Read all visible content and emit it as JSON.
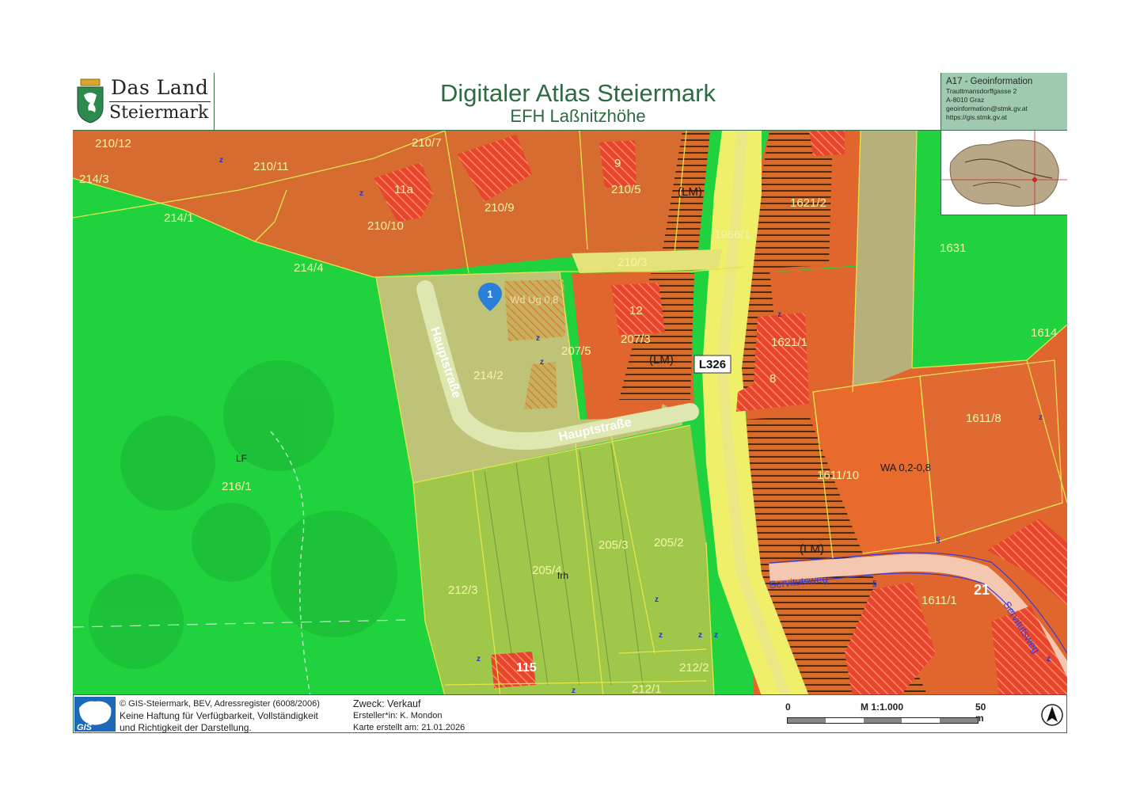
{
  "header": {
    "logo_line1": "Das Land",
    "logo_line2": "Steiermark",
    "title": "Digitaler Atlas Steiermark",
    "subtitle": "EFH Laßnitzhöhe"
  },
  "info": {
    "department": "A17 - Geoinformation",
    "street": "Trauttmansdorffgasse 2",
    "city": "A-8010 Graz",
    "email": "geoinformation@stmk.gv.at",
    "web": "https://gis.stmk.gv.at"
  },
  "map": {
    "parcels": [
      "210/12",
      "210/7",
      "210/11",
      "214/3",
      "214/1",
      "11a",
      "210/10",
      "210/9",
      "9",
      "210/5",
      "(LM)",
      "1621/2",
      "1966/1",
      "1631",
      "214/4",
      "210/3",
      "1",
      "12",
      "207/3",
      "207/5",
      "214/2",
      "(LM)",
      "1621/1",
      "8",
      "1614",
      "Hauptstraße",
      "Hauptstraße",
      "1611/8",
      "LF",
      "216/1",
      "1611/10",
      "WA 0,2-0,8",
      "205/3",
      "205/2",
      "(LM)",
      "205/4",
      "frh",
      "212/3",
      "Servitutsweg",
      "1611/1",
      "21",
      "Servitutsweg",
      "115",
      "212/2",
      "212/1"
    ],
    "road_label": "L326",
    "marker_label": "1",
    "marker_text": "Wd Ug 0,8",
    "colors": {
      "forest_green": "#1fd23c",
      "building_orange": "#e0662e",
      "road_yellow": "#f0ef6a",
      "hatch_red": "#e8452e",
      "parcel_line": "#e3e64d",
      "marker_blue": "#2b7fd8"
    }
  },
  "footer": {
    "copyright": "© GIS-Steiermark, BEV, Adressregister (6008/2006)",
    "disclaimer_1": "Keine Haftung für Verfügbarkeit, Vollständigkeit",
    "disclaimer_2": "und Richtigkeit der Darstellung.",
    "purpose": "Zweck: Verkauf",
    "creator": "Ersteller*in: K. Mondon",
    "created": "Karte erstellt am: 21.01.2026",
    "scale_start": "0",
    "scale_ratio": "M 1:1.000",
    "scale_end": "50 m",
    "gis_logo_text": "GIS"
  }
}
